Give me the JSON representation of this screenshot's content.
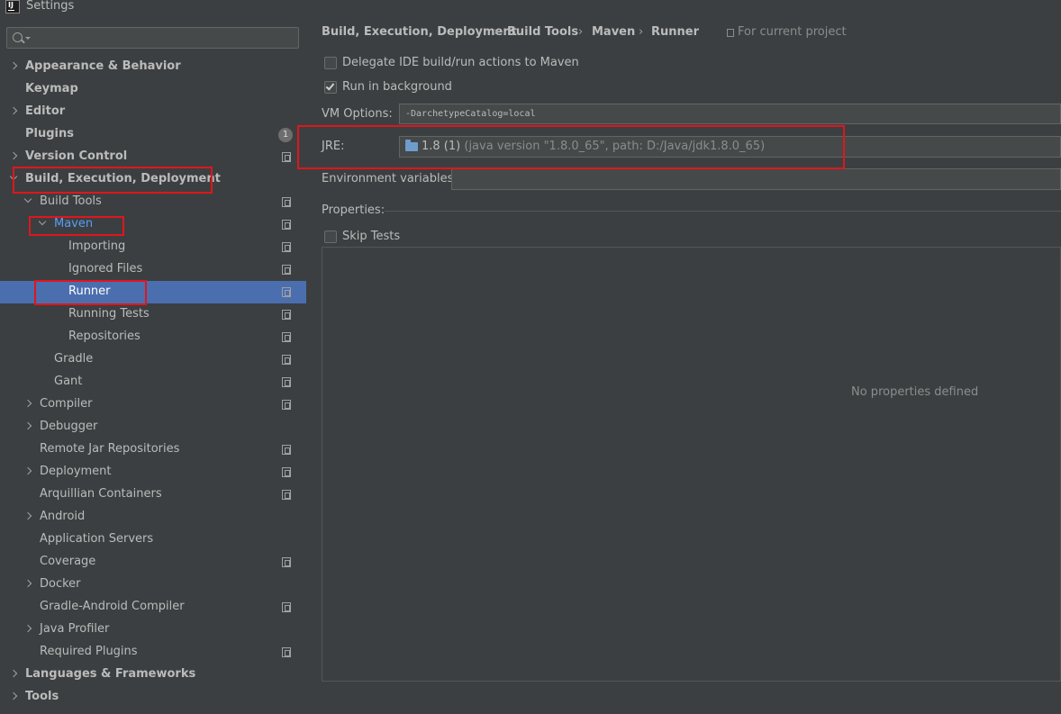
{
  "window": {
    "title": "Settings"
  },
  "search": {
    "placeholder": ""
  },
  "sidebar": {
    "items": [
      {
        "label": "Appearance & Behavior",
        "bold": true,
        "level": 0,
        "arrow": "right"
      },
      {
        "label": "Keymap",
        "bold": true,
        "level": 0,
        "arrow": "none"
      },
      {
        "label": "Editor",
        "bold": true,
        "level": 0,
        "arrow": "right"
      },
      {
        "label": "Plugins",
        "bold": true,
        "level": 0,
        "arrow": "none",
        "badge": "1"
      },
      {
        "label": "Version Control",
        "bold": true,
        "level": 0,
        "arrow": "right",
        "proj": true
      },
      {
        "label": "Build, Execution, Deployment",
        "bold": true,
        "level": 0,
        "arrow": "down"
      },
      {
        "label": "Build Tools",
        "level": 1,
        "arrow": "down",
        "proj": true
      },
      {
        "label": "Maven",
        "level": 2,
        "arrow": "down",
        "proj": true,
        "blue": true
      },
      {
        "label": "Importing",
        "level": 3,
        "arrow": "none",
        "proj": true
      },
      {
        "label": "Ignored Files",
        "level": 3,
        "arrow": "none",
        "proj": true
      },
      {
        "label": "Runner",
        "level": 3,
        "arrow": "none",
        "proj": true,
        "selected": true
      },
      {
        "label": "Running Tests",
        "level": 3,
        "arrow": "none",
        "proj": true
      },
      {
        "label": "Repositories",
        "level": 3,
        "arrow": "none",
        "proj": true
      },
      {
        "label": "Gradle",
        "level": 2,
        "arrow": "none",
        "proj": true
      },
      {
        "label": "Gant",
        "level": 2,
        "arrow": "none",
        "proj": true
      },
      {
        "label": "Compiler",
        "level": 1,
        "arrow": "right",
        "proj": true
      },
      {
        "label": "Debugger",
        "level": 1,
        "arrow": "right"
      },
      {
        "label": "Remote Jar Repositories",
        "level": 1,
        "arrow": "none",
        "proj": true
      },
      {
        "label": "Deployment",
        "level": 1,
        "arrow": "right",
        "proj": true
      },
      {
        "label": "Arquillian Containers",
        "level": 1,
        "arrow": "none",
        "proj": true
      },
      {
        "label": "Android",
        "level": 1,
        "arrow": "right"
      },
      {
        "label": "Application Servers",
        "level": 1,
        "arrow": "none"
      },
      {
        "label": "Coverage",
        "level": 1,
        "arrow": "none",
        "proj": true
      },
      {
        "label": "Docker",
        "level": 1,
        "arrow": "right"
      },
      {
        "label": "Gradle-Android Compiler",
        "level": 1,
        "arrow": "none",
        "proj": true
      },
      {
        "label": "Java Profiler",
        "level": 1,
        "arrow": "right"
      },
      {
        "label": "Required Plugins",
        "level": 1,
        "arrow": "none",
        "proj": true
      },
      {
        "label": "Languages & Frameworks",
        "bold": true,
        "level": 0,
        "arrow": "right"
      },
      {
        "label": "Tools",
        "bold": true,
        "level": 0,
        "arrow": "right"
      }
    ]
  },
  "breadcrumb": {
    "items": [
      "Build, Execution, Deployment",
      "Build Tools",
      "Maven",
      "Runner"
    ],
    "separator": "›",
    "scope": "For current project"
  },
  "runner": {
    "delegate_label": "Delegate IDE build/run actions to Maven",
    "delegate_checked": false,
    "background_label": "Run in background",
    "background_checked": true,
    "vm_options_label": "VM Options:",
    "vm_options_value": "-DarchetypeCatalog=local",
    "jre_label": "JRE:",
    "jre_value": "1.8 (1)",
    "jre_detail": "(java version \"1.8.0_65\", path: D:/Java/jdk1.8.0_65)",
    "env_label": "Environment variables:",
    "env_value": "",
    "properties_label": "Properties:",
    "skip_tests_label": "Skip Tests",
    "skip_tests_checked": false,
    "no_properties": "No properties defined"
  },
  "colors": {
    "background": "#3c3f41",
    "selection": "#4b6eaf",
    "highlight_box": "#e0161b",
    "link_blue": "#589df6"
  }
}
